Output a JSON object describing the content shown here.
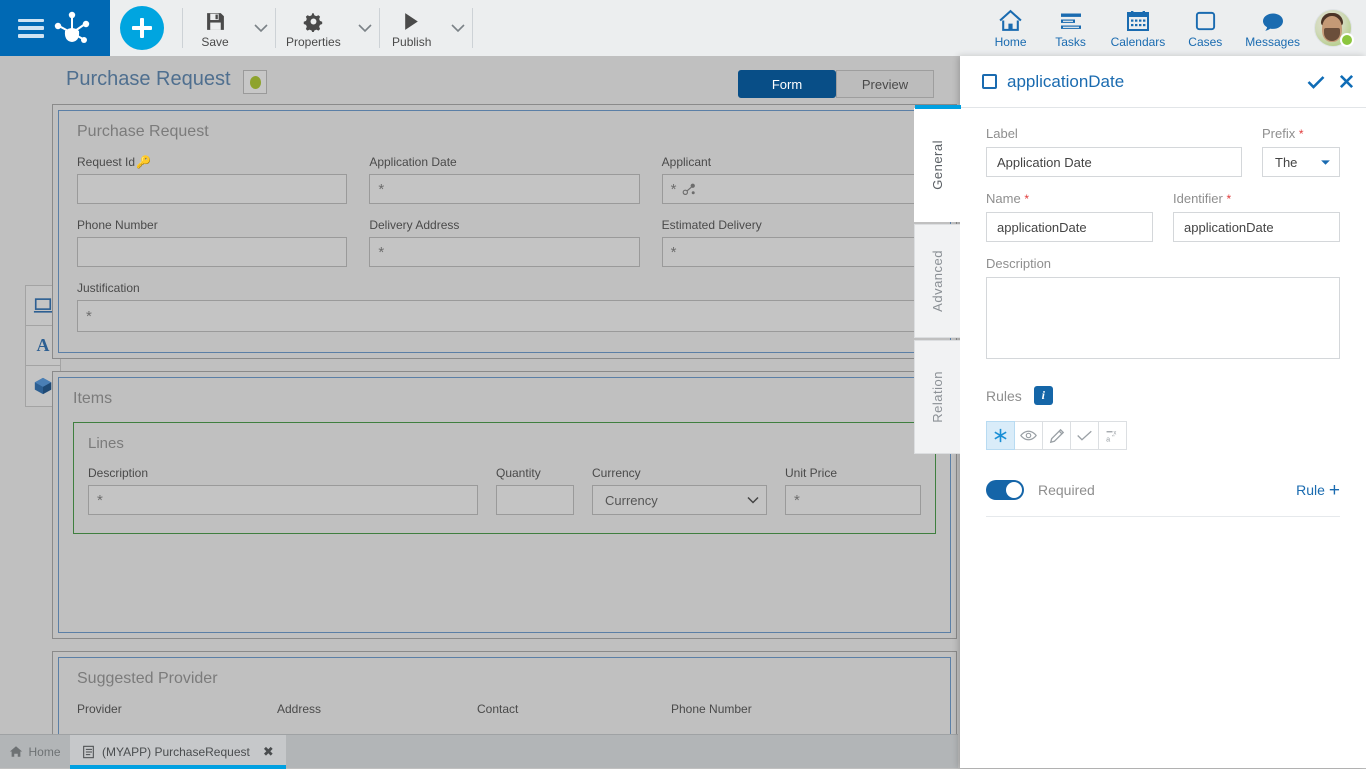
{
  "toolbar": {
    "menu_icon": "hamburger-icon",
    "logo_icon": "bizagi-logo-icon",
    "add_label": "+",
    "items": [
      {
        "label": "Save",
        "icon": "save-icon"
      },
      {
        "label": "Properties",
        "icon": "gear-icon"
      },
      {
        "label": "Publish",
        "icon": "play-icon"
      }
    ],
    "right_items": [
      {
        "label": "Home",
        "icon": "home-icon"
      },
      {
        "label": "Tasks",
        "icon": "tasks-icon"
      },
      {
        "label": "Calendars",
        "icon": "calendar-icon"
      },
      {
        "label": "Cases",
        "icon": "cases-icon"
      },
      {
        "label": "Messages",
        "icon": "message-icon"
      }
    ],
    "avatar": {
      "name": "avatar",
      "status": "online"
    }
  },
  "page": {
    "title": "Purchase Request",
    "status_indicator": "green",
    "mode_tabs": [
      {
        "label": "Form",
        "active": true
      },
      {
        "label": "Preview",
        "active": false
      }
    ]
  },
  "rail": {
    "items": [
      {
        "icon": "monitor-icon"
      },
      {
        "icon": "typography-icon",
        "label": "A"
      },
      {
        "icon": "cube-icon"
      }
    ]
  },
  "form": {
    "groups": [
      {
        "title": "Purchase Request",
        "rows": [
          [
            {
              "label": "Request Id",
              "key_icon": true,
              "marker": ""
            },
            {
              "label": "Application Date",
              "marker": "*"
            },
            {
              "label": "Applicant",
              "marker": "*",
              "relation_icon": true
            }
          ],
          [
            {
              "label": "Phone Number",
              "marker": ""
            },
            {
              "label": "Delivery Address",
              "marker": "*"
            },
            {
              "label": "Estimated Delivery",
              "marker": "*"
            }
          ],
          [
            {
              "label": "Justification",
              "marker": "*",
              "wide": true
            }
          ]
        ]
      },
      {
        "title": "Items",
        "sub_title": "Lines",
        "line_fields": [
          {
            "label": "Description",
            "marker": "*"
          },
          {
            "label": "Quantity",
            "marker": ""
          },
          {
            "label": "Currency",
            "marker": "",
            "type": "select",
            "value": "Currency"
          },
          {
            "label": "Unit Price",
            "marker": "*"
          }
        ]
      },
      {
        "title": "Suggested Provider",
        "columns": [
          "Provider",
          "Address",
          "Contact",
          "Phone Number"
        ]
      }
    ]
  },
  "properties_panel": {
    "title": "applicationDate",
    "checkbox_checked": false,
    "confirm_icon": "check-icon",
    "close_icon": "close-icon",
    "tabs": [
      {
        "label": "General",
        "active": true
      },
      {
        "label": "Advanced",
        "active": false
      },
      {
        "label": "Relation",
        "active": false
      }
    ],
    "fields": {
      "label_label": "Label",
      "label_value": "Application Date",
      "prefix_label": "Prefix",
      "prefix_required": "*",
      "prefix_value": "The",
      "name_label": "Name",
      "name_required": "*",
      "name_value": "applicationDate",
      "identifier_label": "Identifier",
      "identifier_required": "*",
      "identifier_value": "applicationDate",
      "description_label": "Description",
      "description_value": ""
    },
    "rules": {
      "label": "Rules",
      "info_badge": "i",
      "icons": [
        {
          "name": "required-asterisk-icon",
          "active": true
        },
        {
          "name": "visible-eye-icon",
          "active": false
        },
        {
          "name": "editable-pencil-icon",
          "active": false
        },
        {
          "name": "valid-check-icon",
          "active": false
        },
        {
          "name": "format-mask-icon",
          "active": false
        }
      ],
      "toggle_on": true,
      "toggle_label": "Required",
      "add_rule_label": "Rule",
      "add_rule_plus": "+"
    }
  },
  "taskbar": {
    "home_label": "Home",
    "tabs": [
      {
        "label": "(MYAPP) PurchaseRequest",
        "active": true,
        "close": "✖"
      }
    ]
  },
  "colors": {
    "brand_blue": "#0069b4",
    "accent_cyan": "#00a5e0",
    "active_tab_blue": "#084e87",
    "link_blue": "#1a6bb0",
    "status_green": "#8cc63e",
    "canvas_gray": "#c0c0c0"
  }
}
